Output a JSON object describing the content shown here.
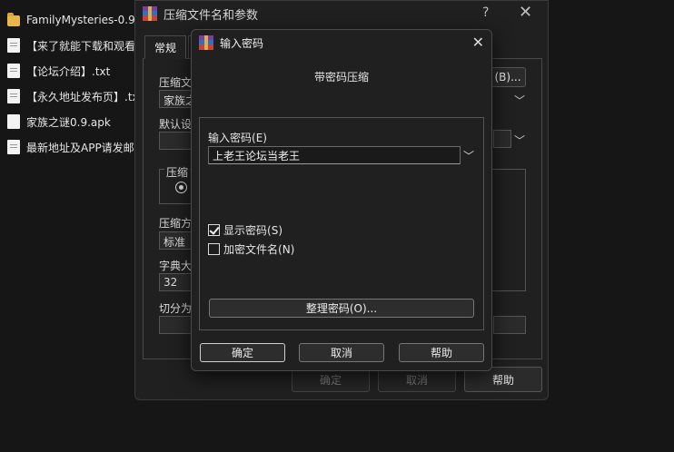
{
  "explorer": {
    "files": [
      {
        "icon": "folder-icon",
        "label": "FamilyMysteries-0.9-"
      },
      {
        "icon": "text-file-icon",
        "label": "【来了就能下载和观看"
      },
      {
        "icon": "text-file-icon",
        "label": "【论坛介绍】.txt"
      },
      {
        "icon": "text-file-icon",
        "label": "【永久地址发布页】.tx"
      },
      {
        "icon": "file-icon",
        "label": "家族之谜0.9.apk"
      },
      {
        "icon": "text-file-icon",
        "label": "最新地址及APP请发邮"
      }
    ]
  },
  "bg_dialog": {
    "title": "压缩文件名和参数",
    "help_glyph": "?",
    "close_glyph": "✕",
    "tab_general": "常规",
    "archive_name_label": "压缩文",
    "archive_name_value": "家族之",
    "browse_button": "(B)...",
    "default_label": "默认设",
    "format_label": "压缩",
    "method_label": "压缩方",
    "method_value": "标准",
    "dict_label": "字典大",
    "dict_value": "32",
    "split_label": "切分为",
    "ok_button": "确定",
    "cancel_button": "取消",
    "help_button": "帮助"
  },
  "pw_dialog": {
    "title": "输入密码",
    "close_glyph": "✕",
    "header": "带密码压缩",
    "password_label": "输入密码",
    "password_hotkey": "(E)",
    "password_value": "上老王论坛当老王",
    "show_password_label": "显示密码",
    "show_password_hotkey": "(S)",
    "show_password_checked": true,
    "encrypt_names_label": "加密文件名",
    "encrypt_names_hotkey": "(N)",
    "encrypt_names_checked": false,
    "organize_button": "整理密码(O)...",
    "ok_button": "确定",
    "cancel_button": "取消",
    "help_button": "帮助"
  }
}
